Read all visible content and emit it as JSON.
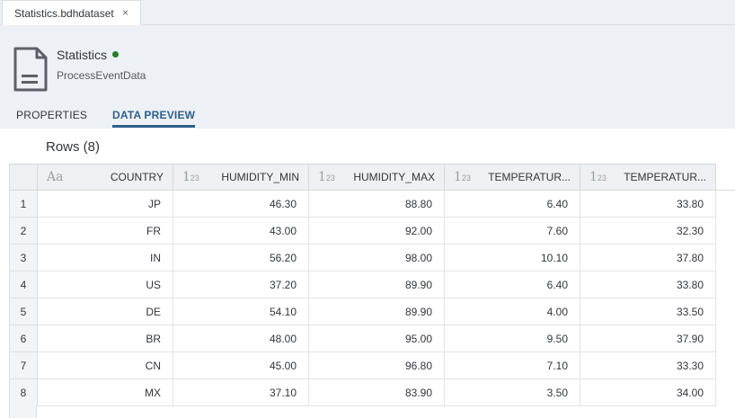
{
  "tab": {
    "title": "Statistics.bdhdataset",
    "close": "×"
  },
  "header": {
    "title": "Statistics",
    "subtitle": "ProcessEventData",
    "status_color": "#2b7d2b",
    "tabs": [
      "PROPERTIES",
      "DATA PREVIEW"
    ],
    "active_tab": "DATA PREVIEW"
  },
  "preview": {
    "rows_label": "Rows (8)",
    "columns": [
      {
        "label": "COUNTRY",
        "type_icon": "string-type-icon",
        "type_glyph": "Aa"
      },
      {
        "label": "HUMIDITY_MIN",
        "type_icon": "number-type-icon",
        "type_glyph": "1",
        "type_sub": "23"
      },
      {
        "label": "HUMIDITY_MAX",
        "type_icon": "number-type-icon",
        "type_glyph": "1",
        "type_sub": "23"
      },
      {
        "label": "TEMPERATUR...",
        "type_icon": "number-type-icon",
        "type_glyph": "1",
        "type_sub": "23"
      },
      {
        "label": "TEMPERATUR...",
        "type_icon": "number-type-icon",
        "type_glyph": "1",
        "type_sub": "23"
      }
    ],
    "rows": [
      [
        "1",
        "JP",
        "46.30",
        "88.80",
        "6.40",
        "33.80"
      ],
      [
        "2",
        "FR",
        "43.00",
        "92.00",
        "7.60",
        "32.30"
      ],
      [
        "3",
        "IN",
        "56.20",
        "98.00",
        "10.10",
        "37.80"
      ],
      [
        "4",
        "US",
        "37.20",
        "89.90",
        "6.40",
        "33.80"
      ],
      [
        "5",
        "DE",
        "54.10",
        "89.90",
        "4.00",
        "33.50"
      ],
      [
        "6",
        "BR",
        "48.00",
        "95.00",
        "9.50",
        "37.90"
      ],
      [
        "7",
        "CN",
        "45.00",
        "96.80",
        "7.10",
        "33.30"
      ],
      [
        "8",
        "MX",
        "37.10",
        "83.90",
        "3.50",
        "34.00"
      ]
    ]
  }
}
